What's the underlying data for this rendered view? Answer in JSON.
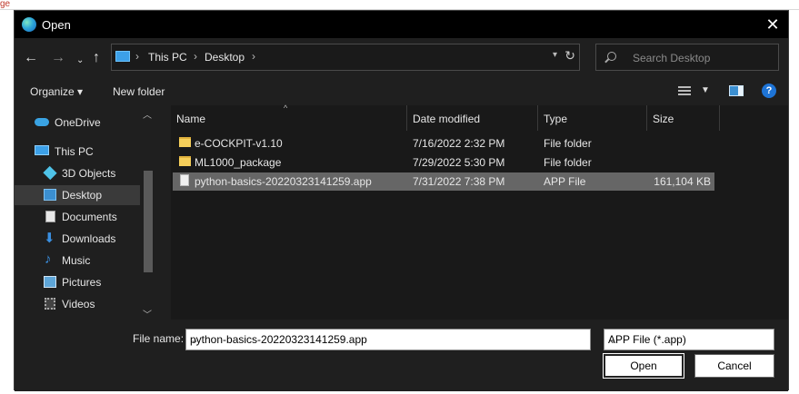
{
  "background": {
    "partial_text": "ge"
  },
  "titlebar": {
    "title": "Open",
    "app_icon": "edge-icon",
    "close_glyph": "✕"
  },
  "navigation": {
    "back": "back-arrow-icon",
    "forward": "forward-arrow-icon",
    "recent": "chevron-down-icon",
    "up": "up-arrow-icon"
  },
  "address_bar": {
    "breadcrumbs": [
      "This PC",
      "Desktop"
    ],
    "separator": "›"
  },
  "search": {
    "placeholder": "Search Desktop"
  },
  "toolbar": {
    "organize": "Organize",
    "new_folder": "New folder"
  },
  "nav_pane": {
    "items": [
      {
        "label": "OneDrive",
        "icon": "cloud-icon"
      },
      {
        "label": "This PC",
        "icon": "monitor-icon"
      },
      {
        "label": "3D Objects",
        "icon": "cube-icon"
      },
      {
        "label": "Desktop",
        "icon": "desktop-icon",
        "selected": true
      },
      {
        "label": "Documents",
        "icon": "document-icon"
      },
      {
        "label": "Downloads",
        "icon": "download-icon"
      },
      {
        "label": "Music",
        "icon": "music-icon"
      },
      {
        "label": "Pictures",
        "icon": "pictures-icon"
      },
      {
        "label": "Videos",
        "icon": "video-icon"
      }
    ]
  },
  "file_list": {
    "columns": [
      "Name",
      "Date modified",
      "Type",
      "Size"
    ],
    "rows": [
      {
        "name": "e-COCKPIT-v1.10",
        "date": "7/16/2022 2:32 PM",
        "type": "File folder",
        "size": "",
        "icon": "folder-icon"
      },
      {
        "name": "ML1000_package",
        "date": "7/29/2022 5:30 PM",
        "type": "File folder",
        "size": "",
        "icon": "folder-icon"
      },
      {
        "name": "python-basics-20220323141259.app",
        "date": "7/31/2022 7:38 PM",
        "type": "APP File",
        "size": "161,104 KB",
        "icon": "file-icon",
        "selected": true
      }
    ]
  },
  "bottom": {
    "file_name_label": "File name:",
    "file_name_value": "python-basics-20220323141259.app",
    "file_type": "APP File (*.app)",
    "open_label": "Open",
    "cancel_label": "Cancel"
  }
}
